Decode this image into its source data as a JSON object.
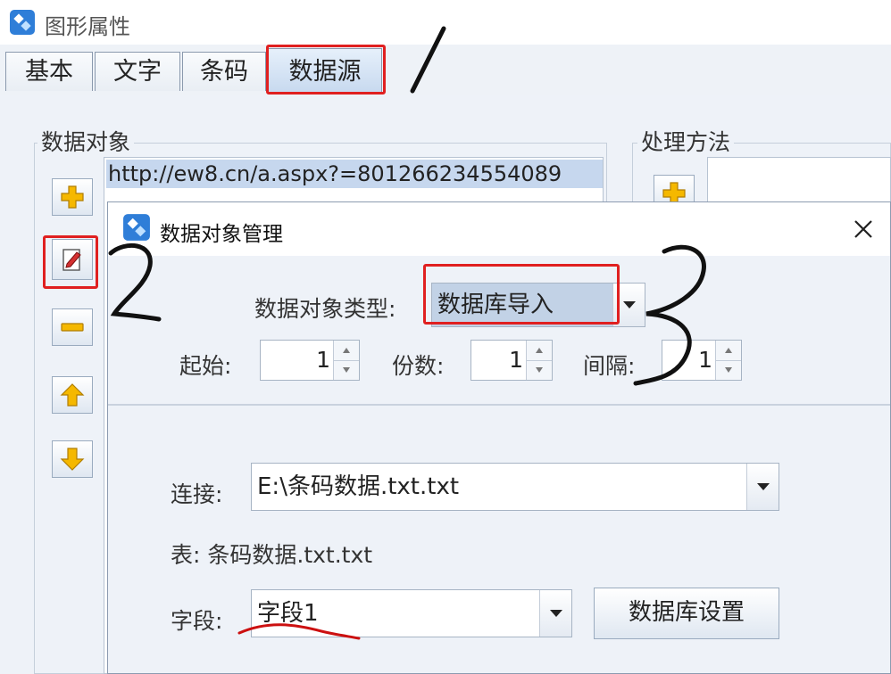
{
  "outer_window": {
    "title": "图形属性",
    "tabs": [
      {
        "label": "基本"
      },
      {
        "label": "文字"
      },
      {
        "label": "条码"
      },
      {
        "label": "数据源"
      }
    ],
    "active_tab": "数据源"
  },
  "data_object_group": {
    "title": "数据对象",
    "list_items": [
      "http://ew8.cn/a.aspx?=801266234554089"
    ]
  },
  "processing_group": {
    "title": "处理方法"
  },
  "dialog": {
    "title": "数据对象管理",
    "type_label": "数据对象类型:",
    "type_value": "数据库导入",
    "start_label": "起始:",
    "start_value": "1",
    "copies_label": "份数:",
    "copies_value": "1",
    "interval_label": "间隔:",
    "interval_value": "1",
    "connection_label": "连接:",
    "connection_value": "E:\\条码数据.txt.txt",
    "table_text": "表: 条码数据.txt.txt",
    "field_label": "字段:",
    "field_value": "字段1",
    "db_settings_button": "数据库设置"
  },
  "annotations": {
    "step1": "1",
    "step2": "2",
    "step3": "3",
    "highlight_color": "#e02020",
    "ink_color": "#111111",
    "underline_color": "#cc1010"
  }
}
